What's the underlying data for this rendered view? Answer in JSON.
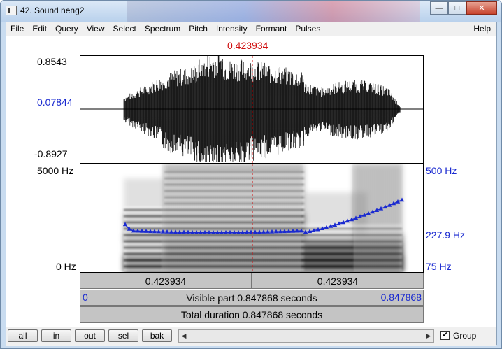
{
  "window": {
    "title": "42. Sound neng2",
    "minimize_glyph": "—",
    "maximize_glyph": "□",
    "close_glyph": "✕"
  },
  "menubar": {
    "items": [
      "File",
      "Edit",
      "Query",
      "View",
      "Select",
      "Spectrum",
      "Pitch",
      "Intensity",
      "Formant",
      "Pulses"
    ],
    "help": "Help"
  },
  "editor": {
    "cursor_time": "0.423934",
    "wave_max": "0.8543",
    "wave_mid": "0.07844",
    "wave_min": "-0.8927",
    "spec_top": "5000 Hz",
    "spec_bottom": "0 Hz",
    "pitch_top": "500 Hz",
    "pitch_cursor": "227.9 Hz",
    "pitch_bottom": "75 Hz",
    "left_segment": "0.423934",
    "right_segment": "0.423934",
    "visible_start": "0",
    "visible_text": "Visible part 0.847868 seconds",
    "visible_end": "0.847868",
    "total_text": "Total duration 0.847868 seconds"
  },
  "bottom": {
    "buttons": [
      "all",
      "in",
      "out",
      "sel",
      "bak"
    ],
    "group_label": "Group",
    "group_checked": "✔"
  },
  "colors": {
    "pitch_line": "#1a2ad0",
    "cursor": "#d01010"
  }
}
